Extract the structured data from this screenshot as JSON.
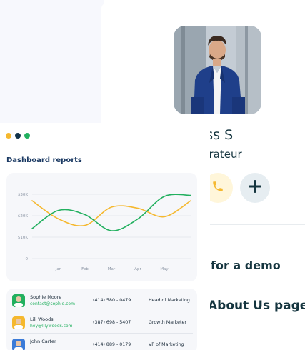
{
  "profile": {
    "name_partial": "iss S",
    "role_partial": "urateur",
    "demo_link": "for a demo",
    "about_link": "About Us page",
    "accent_phone_bg": "#fff6da",
    "accent_plus_bg": "#e6edf1",
    "icons": [
      "phone-icon",
      "plus-icon"
    ]
  },
  "dashboard": {
    "window_dots": [
      "#f5b82e",
      "#12334a",
      "#22b05f"
    ],
    "title": "Dashboard reports",
    "contacts": [
      {
        "name": "Sophie Moore",
        "email": "contact@sophie.com",
        "phone": "(414) 580 - 0479",
        "role": "Head of Marketing",
        "avatar_color": "#22b05f"
      },
      {
        "name": "Lili Woods",
        "email": "hey@lilywoods.com",
        "phone": "(387) 698 - 5407",
        "role": "Growth Marketer",
        "avatar_color": "#f5b82e"
      },
      {
        "name": "John Carter",
        "email": "",
        "phone": "(414) 889 - 0179",
        "role": "VP of Marketing",
        "avatar_color": "#3b7bd8"
      }
    ]
  },
  "chart_data": {
    "type": "line",
    "categories": [
      "Jan",
      "Feb",
      "Mar",
      "Apr",
      "May"
    ],
    "yticks": [
      "$30K",
      "$20K",
      "$10K",
      "0"
    ],
    "ylim": [
      0,
      30000
    ],
    "grid": true,
    "series": [
      {
        "color": "#f5b82e",
        "values": [
          27000,
          18500,
          15500,
          24000,
          23500,
          19500,
          27000
        ]
      },
      {
        "color": "#22b05f",
        "values": [
          14000,
          22500,
          20500,
          13000,
          18500,
          29000,
          29500
        ]
      }
    ],
    "x_positions": [
      0,
      1,
      2,
      3,
      4,
      5,
      6
    ]
  }
}
